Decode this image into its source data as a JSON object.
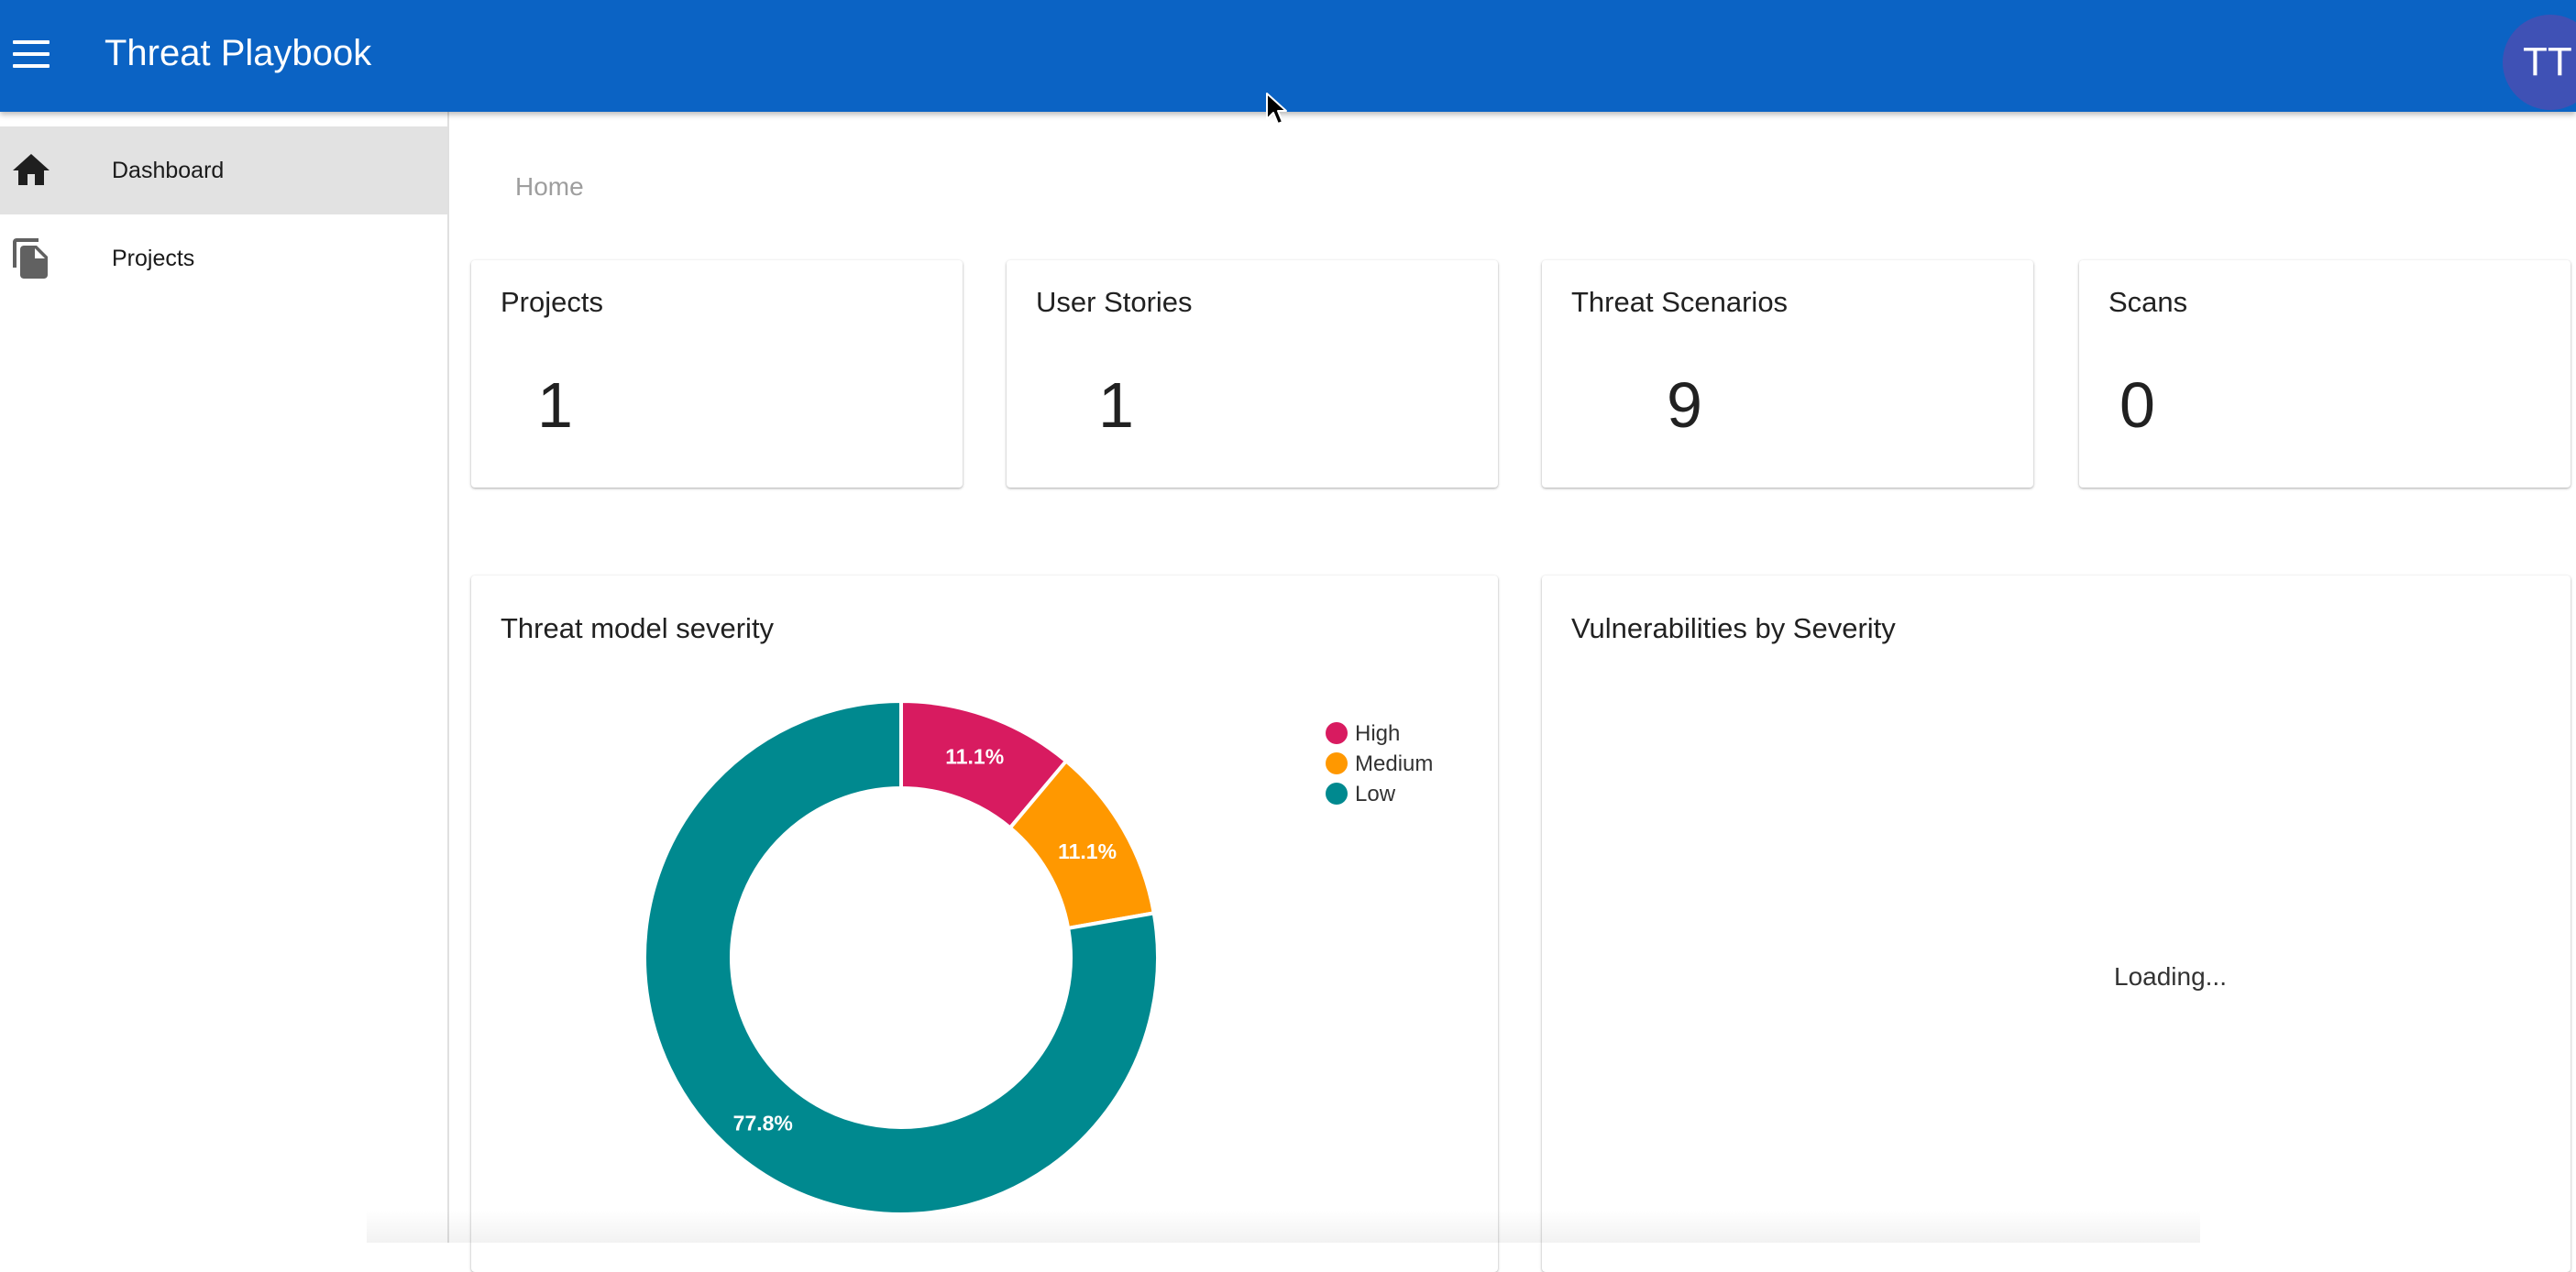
{
  "app": {
    "title": "Threat Playbook",
    "avatar_initials": "TT"
  },
  "sidebar": {
    "items": [
      {
        "label": "Dashboard",
        "icon": "home-icon",
        "active": true
      },
      {
        "label": "Projects",
        "icon": "file-copy-icon",
        "active": false
      }
    ]
  },
  "breadcrumb": {
    "home": "Home"
  },
  "stats": [
    {
      "title": "Projects",
      "value": "1"
    },
    {
      "title": "User Stories",
      "value": "1"
    },
    {
      "title": "Threat Scenarios",
      "value": "9"
    },
    {
      "title": "Scans",
      "value": "0"
    }
  ],
  "severity_card": {
    "title": "Threat model severity"
  },
  "vuln_card": {
    "title": "Vulnerabilities by Severity",
    "loading_text": "Loading..."
  },
  "colors": {
    "appbar": "#0b63c4",
    "avatar": "#3f51b5",
    "high": "#d81b60",
    "medium": "#ff9800",
    "low": "#00898f"
  },
  "chart_data": {
    "type": "pie",
    "donut": true,
    "title": "Threat model severity",
    "legend_position": "top-right",
    "categories": [
      "High",
      "Medium",
      "Low"
    ],
    "values": [
      1,
      1,
      7
    ],
    "labels": [
      "11.1%",
      "11.1%",
      "77.8%"
    ],
    "colors": [
      "#d81b60",
      "#ff9800",
      "#00898f"
    ]
  }
}
